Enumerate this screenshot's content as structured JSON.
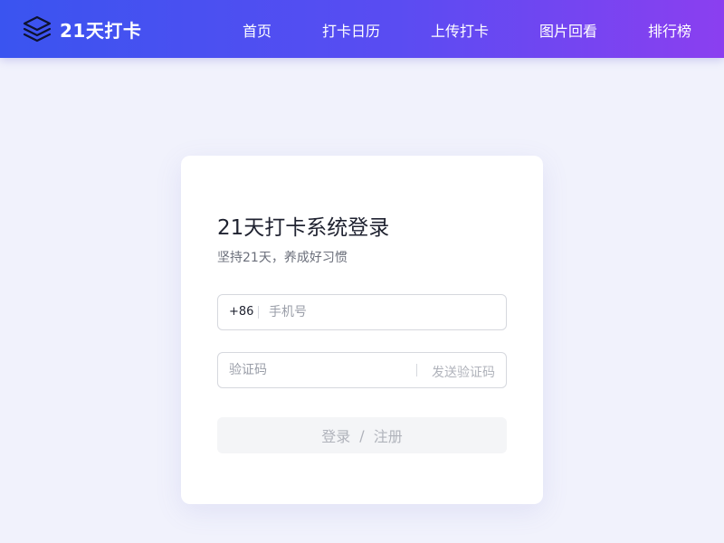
{
  "header": {
    "brand": "21天打卡",
    "brand_icon": "layers-icon",
    "nav": [
      "首页",
      "打卡日历",
      "上传打卡",
      "图片回看",
      "排行榜"
    ]
  },
  "login": {
    "title": "21天打卡系统登录",
    "subtitle": "坚持21天，养成好习惯",
    "country_code": "+86",
    "phone_placeholder": "手机号",
    "code_placeholder": "验证码",
    "send_code": "发送验证码",
    "submit_login": "登录",
    "submit_separator": "/",
    "submit_register": "注册"
  },
  "colors": {
    "header_gradient_start": "#3a54f0",
    "header_gradient_end": "#8b3ff0",
    "page_background": "#f1f2fc",
    "button_disabled": "#f4f5f7"
  }
}
